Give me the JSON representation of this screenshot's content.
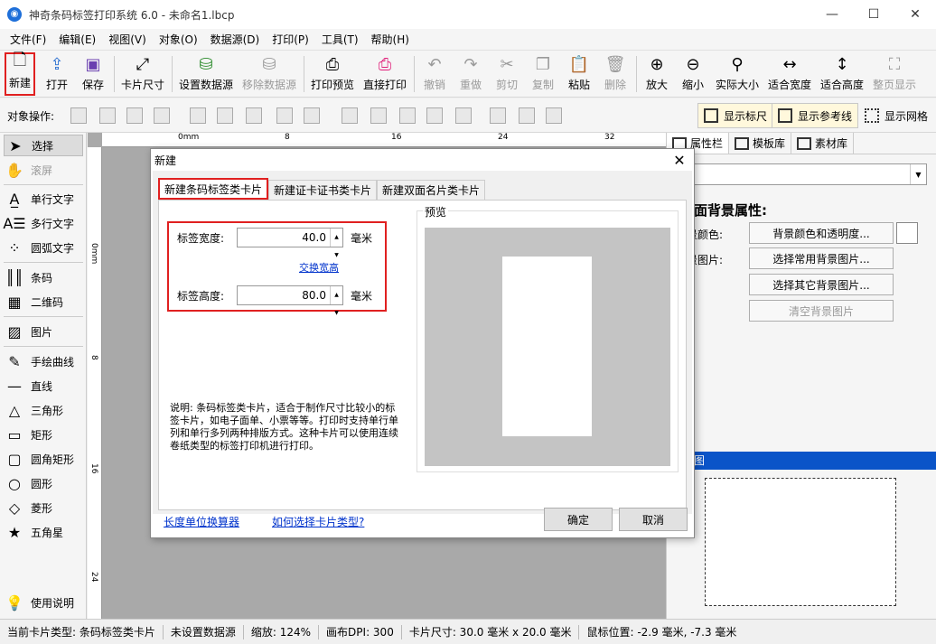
{
  "window": {
    "title": "神奇条码标签打印系统 6.0 - 未命名1.lbcp",
    "app_icon": "app-logo-icon",
    "min": "—",
    "max": "☐",
    "close": "✕"
  },
  "menu": [
    "文件(F)",
    "编辑(E)",
    "视图(V)",
    "对象(O)",
    "数据源(D)",
    "打印(P)",
    "工具(T)",
    "帮助(H)"
  ],
  "toolbar": {
    "new": "新建",
    "open": "打开",
    "save": "保存",
    "card_size": "卡片尺寸",
    "set_datasource": "设置数据源",
    "remove_datasource": "移除数据源",
    "print_preview": "打印预览",
    "direct_print": "直接打印",
    "undo": "撤销",
    "redo": "重做",
    "cut": "剪切",
    "copy": "复制",
    "paste": "粘贴",
    "delete": "删除",
    "zoom_in": "放大",
    "zoom_out": "缩小",
    "actual_size": "实际大小",
    "fit_width": "适合宽度",
    "fit_height": "适合高度",
    "full_page": "整页显示"
  },
  "objbar": {
    "label": "对象操作:",
    "show_ruler": "显示标尺",
    "show_guides": "显示参考线",
    "show_grid": "显示网格"
  },
  "tools": {
    "select": "选择",
    "scroll": "滚屏",
    "single_text": "单行文字",
    "multi_text": "多行文字",
    "arc_text": "圆弧文字",
    "barcode": "条码",
    "qrcode": "二维码",
    "image": "图片",
    "freehand": "手绘曲线",
    "line": "直线",
    "triangle": "三角形",
    "rect": "矩形",
    "round_rect": "圆角矩形",
    "ellipse": "圆形",
    "diamond": "菱形",
    "star": "五角星",
    "help": "使用说明"
  },
  "ruler": {
    "h_labels": [
      "0mm",
      "8",
      "16",
      "24",
      "32"
    ],
    "v_labels": [
      "0mm",
      "8",
      "16",
      "24"
    ]
  },
  "right_panel": {
    "tabs": [
      "属性栏",
      "模板库",
      "素材库"
    ],
    "heading": "面背景属性:",
    "bg_color_label": "景颜色:",
    "bg_image_label": "景图片:",
    "btn_color": "背景颜色和透明度...",
    "btn_common_img": "选择常用背景图片...",
    "btn_other_img": "选择其它背景图片...",
    "btn_clear": "清空背景图片",
    "blue_bar": "图"
  },
  "status": {
    "card_type": "当前卡片类型: 条码标签类卡片",
    "datasource": "未设置数据源",
    "zoom": "缩放: 124%",
    "dpi": "画布DPI: 300",
    "card_size": "卡片尺寸: 30.0 毫米 x 20.0 毫米",
    "mouse": "鼠标位置: -2.9 毫米, -7.3 毫米"
  },
  "dialog": {
    "title": "新建",
    "close": "✕",
    "tabs": [
      "新建条码标签类卡片",
      "新建证卡证书类卡片",
      "新建双面名片类卡片"
    ],
    "width_label": "标签宽度:",
    "width_value": "40.0",
    "height_label": "标签高度:",
    "height_value": "80.0",
    "unit": "毫米",
    "swap_link": "交换宽高",
    "preview_label": "预览",
    "description": "说明: 条码标签类卡片，适合于制作尺寸比较小的标签卡片，如电子面单、小票等等。打印时支持单行单列和单行多列两种排版方式。这种卡片可以使用连续卷纸类型的标签打印机进行打印。",
    "link_unit": "长度单位换算器",
    "link_howto": "如何选择卡片类型?",
    "ok": "确定",
    "cancel": "取消"
  }
}
